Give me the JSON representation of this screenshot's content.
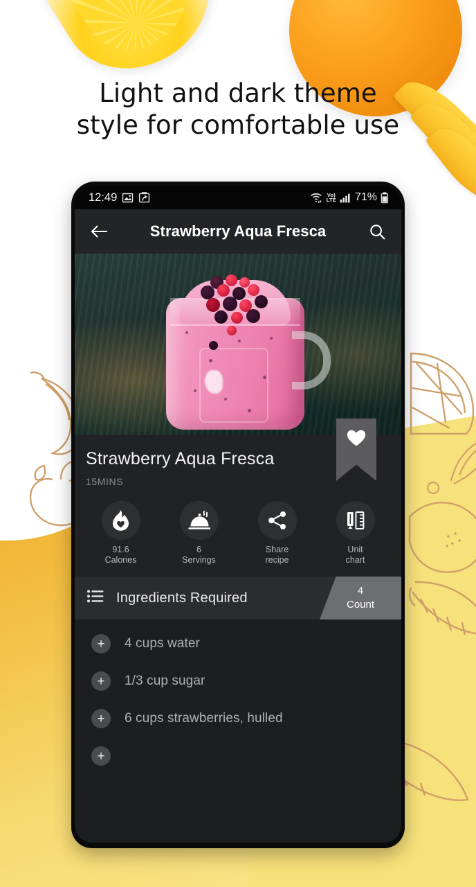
{
  "promo": {
    "headline_line1": "Light and dark theme",
    "headline_line2": "style for comfortable use",
    "colors": {
      "yellow_right": "#F7E17A",
      "yellow_left_dark": "#EFA92C",
      "doodle_line": "#CFA06A",
      "background": "#FFFFFF"
    },
    "decor": {
      "lemon_wedge": "lemon-wedge-photo",
      "orange": "orange-fruit-photo",
      "mango_slices": "mango-slices-photo"
    }
  },
  "phone": {
    "status_bar": {
      "time": "12:49",
      "notification_icons": [
        "image-icon",
        "screenshot-icon"
      ],
      "wifi": "wifi-icon",
      "network_label_top": "Vo)",
      "network_label_bottom": "LTE",
      "signal": "signal-bars-icon",
      "battery_percent": "71%",
      "battery": "battery-icon"
    },
    "app_bar": {
      "back_icon": "back-arrow-icon",
      "title": "Strawberry Aqua Fresca",
      "search_icon": "search-icon"
    },
    "hero": {
      "alt": "strawberry-smoothie-mason-jar-photo"
    },
    "recipe": {
      "title": "Strawberry Aqua Fresca",
      "time": "15MINS",
      "favorite_icon": "heart-icon"
    },
    "actions": [
      {
        "icon": "flame-heart-icon",
        "value": "91.6",
        "label": "Calories"
      },
      {
        "icon": "food-cloche-icon",
        "value": "6",
        "label": "Servings"
      },
      {
        "icon": "share-icon",
        "value": "Share",
        "label": "recipe"
      },
      {
        "icon": "ruler-pencil-icon",
        "value": "Unit",
        "label": "chart"
      }
    ],
    "ingredients_section": {
      "list_icon": "list-icon",
      "title": "Ingredients Required",
      "count_value": "4",
      "count_label": "Count"
    },
    "ingredients": [
      {
        "add_icon": "plus-icon",
        "text": "4 cups water"
      },
      {
        "add_icon": "plus-icon",
        "text": "1/3 cup sugar"
      },
      {
        "add_icon": "plus-icon",
        "text": "6 cups strawberries, hulled"
      }
    ],
    "theme_colors": {
      "app_bar": "#232427",
      "info_panel": "#212225",
      "list_bg": "#1D1E20",
      "section_header": "#2B2C30",
      "badge": "#6D6E71",
      "ribbon": "#5C5C5F"
    }
  }
}
